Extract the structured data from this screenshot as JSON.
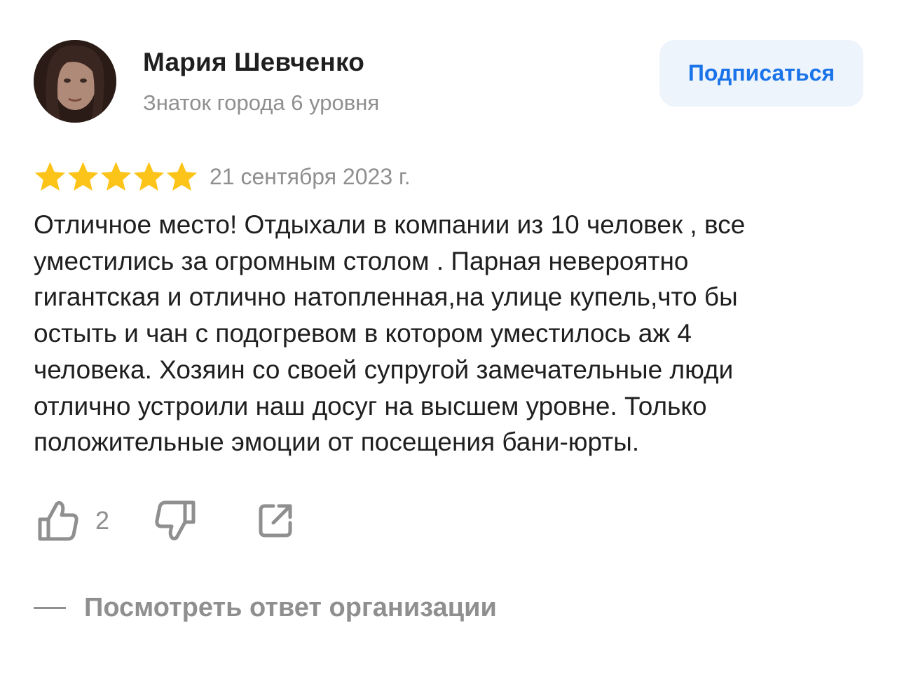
{
  "author": {
    "name": "Мария Шевченко",
    "level": "Знаток города 6 уровня"
  },
  "subscribe": {
    "label": "Подписаться",
    "color": "#1a73e8",
    "background": "#eef4fb"
  },
  "review": {
    "rating": 5,
    "rating_max": 5,
    "star_color": "#fcc419",
    "date": "21 сентября 2023 г.",
    "text_lines": [
      "Отличное место! Отдыхали в компании из 10 человек , все",
      "уместились за огромным столом . Парная невероятно",
      "гигантская и отлично натопленная,на улице купель,что бы",
      "остыть и чан с подогревом в котором уместилось аж 4",
      "человека. Хозяин со своей супругой замечательные люди",
      "отлично устроили наш досуг на высшем уровне. Только",
      "положительные эмоции от посещения бани-юрты."
    ]
  },
  "actions": {
    "like_icon": "thumbs-up-icon",
    "like_count": "2",
    "dislike_icon": "thumbs-down-icon",
    "share_icon": "share-icon"
  },
  "org_answer": {
    "label": "Посмотреть ответ организации"
  },
  "colors": {
    "text": "#1f1f1f",
    "muted": "#8f8f8f"
  }
}
